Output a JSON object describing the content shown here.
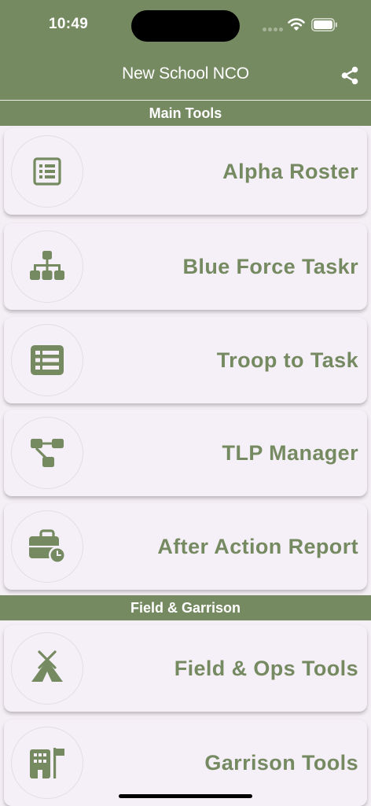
{
  "status_bar": {
    "time": "10:49"
  },
  "header": {
    "title": "New School NCO"
  },
  "sections": [
    {
      "title": "Main Tools",
      "items": [
        {
          "label": "Alpha Roster",
          "icon": "list-alt-icon"
        },
        {
          "label": "Blue Force Taskr",
          "icon": "sitemap-icon"
        },
        {
          "label": "Troop to Task",
          "icon": "list-icon"
        },
        {
          "label": "TLP Manager",
          "icon": "workflow-icon"
        },
        {
          "label": "After Action Report",
          "icon": "business-time-icon"
        }
      ]
    },
    {
      "title": "Field & Garrison",
      "items": [
        {
          "label": "Field & Ops Tools",
          "icon": "tent-icon"
        },
        {
          "label": "Garrison Tools",
          "icon": "building-flag-icon"
        }
      ]
    }
  ],
  "colors": {
    "accent": "#768a62",
    "background": "#f4eff5",
    "card": "#f5f0f7"
  }
}
